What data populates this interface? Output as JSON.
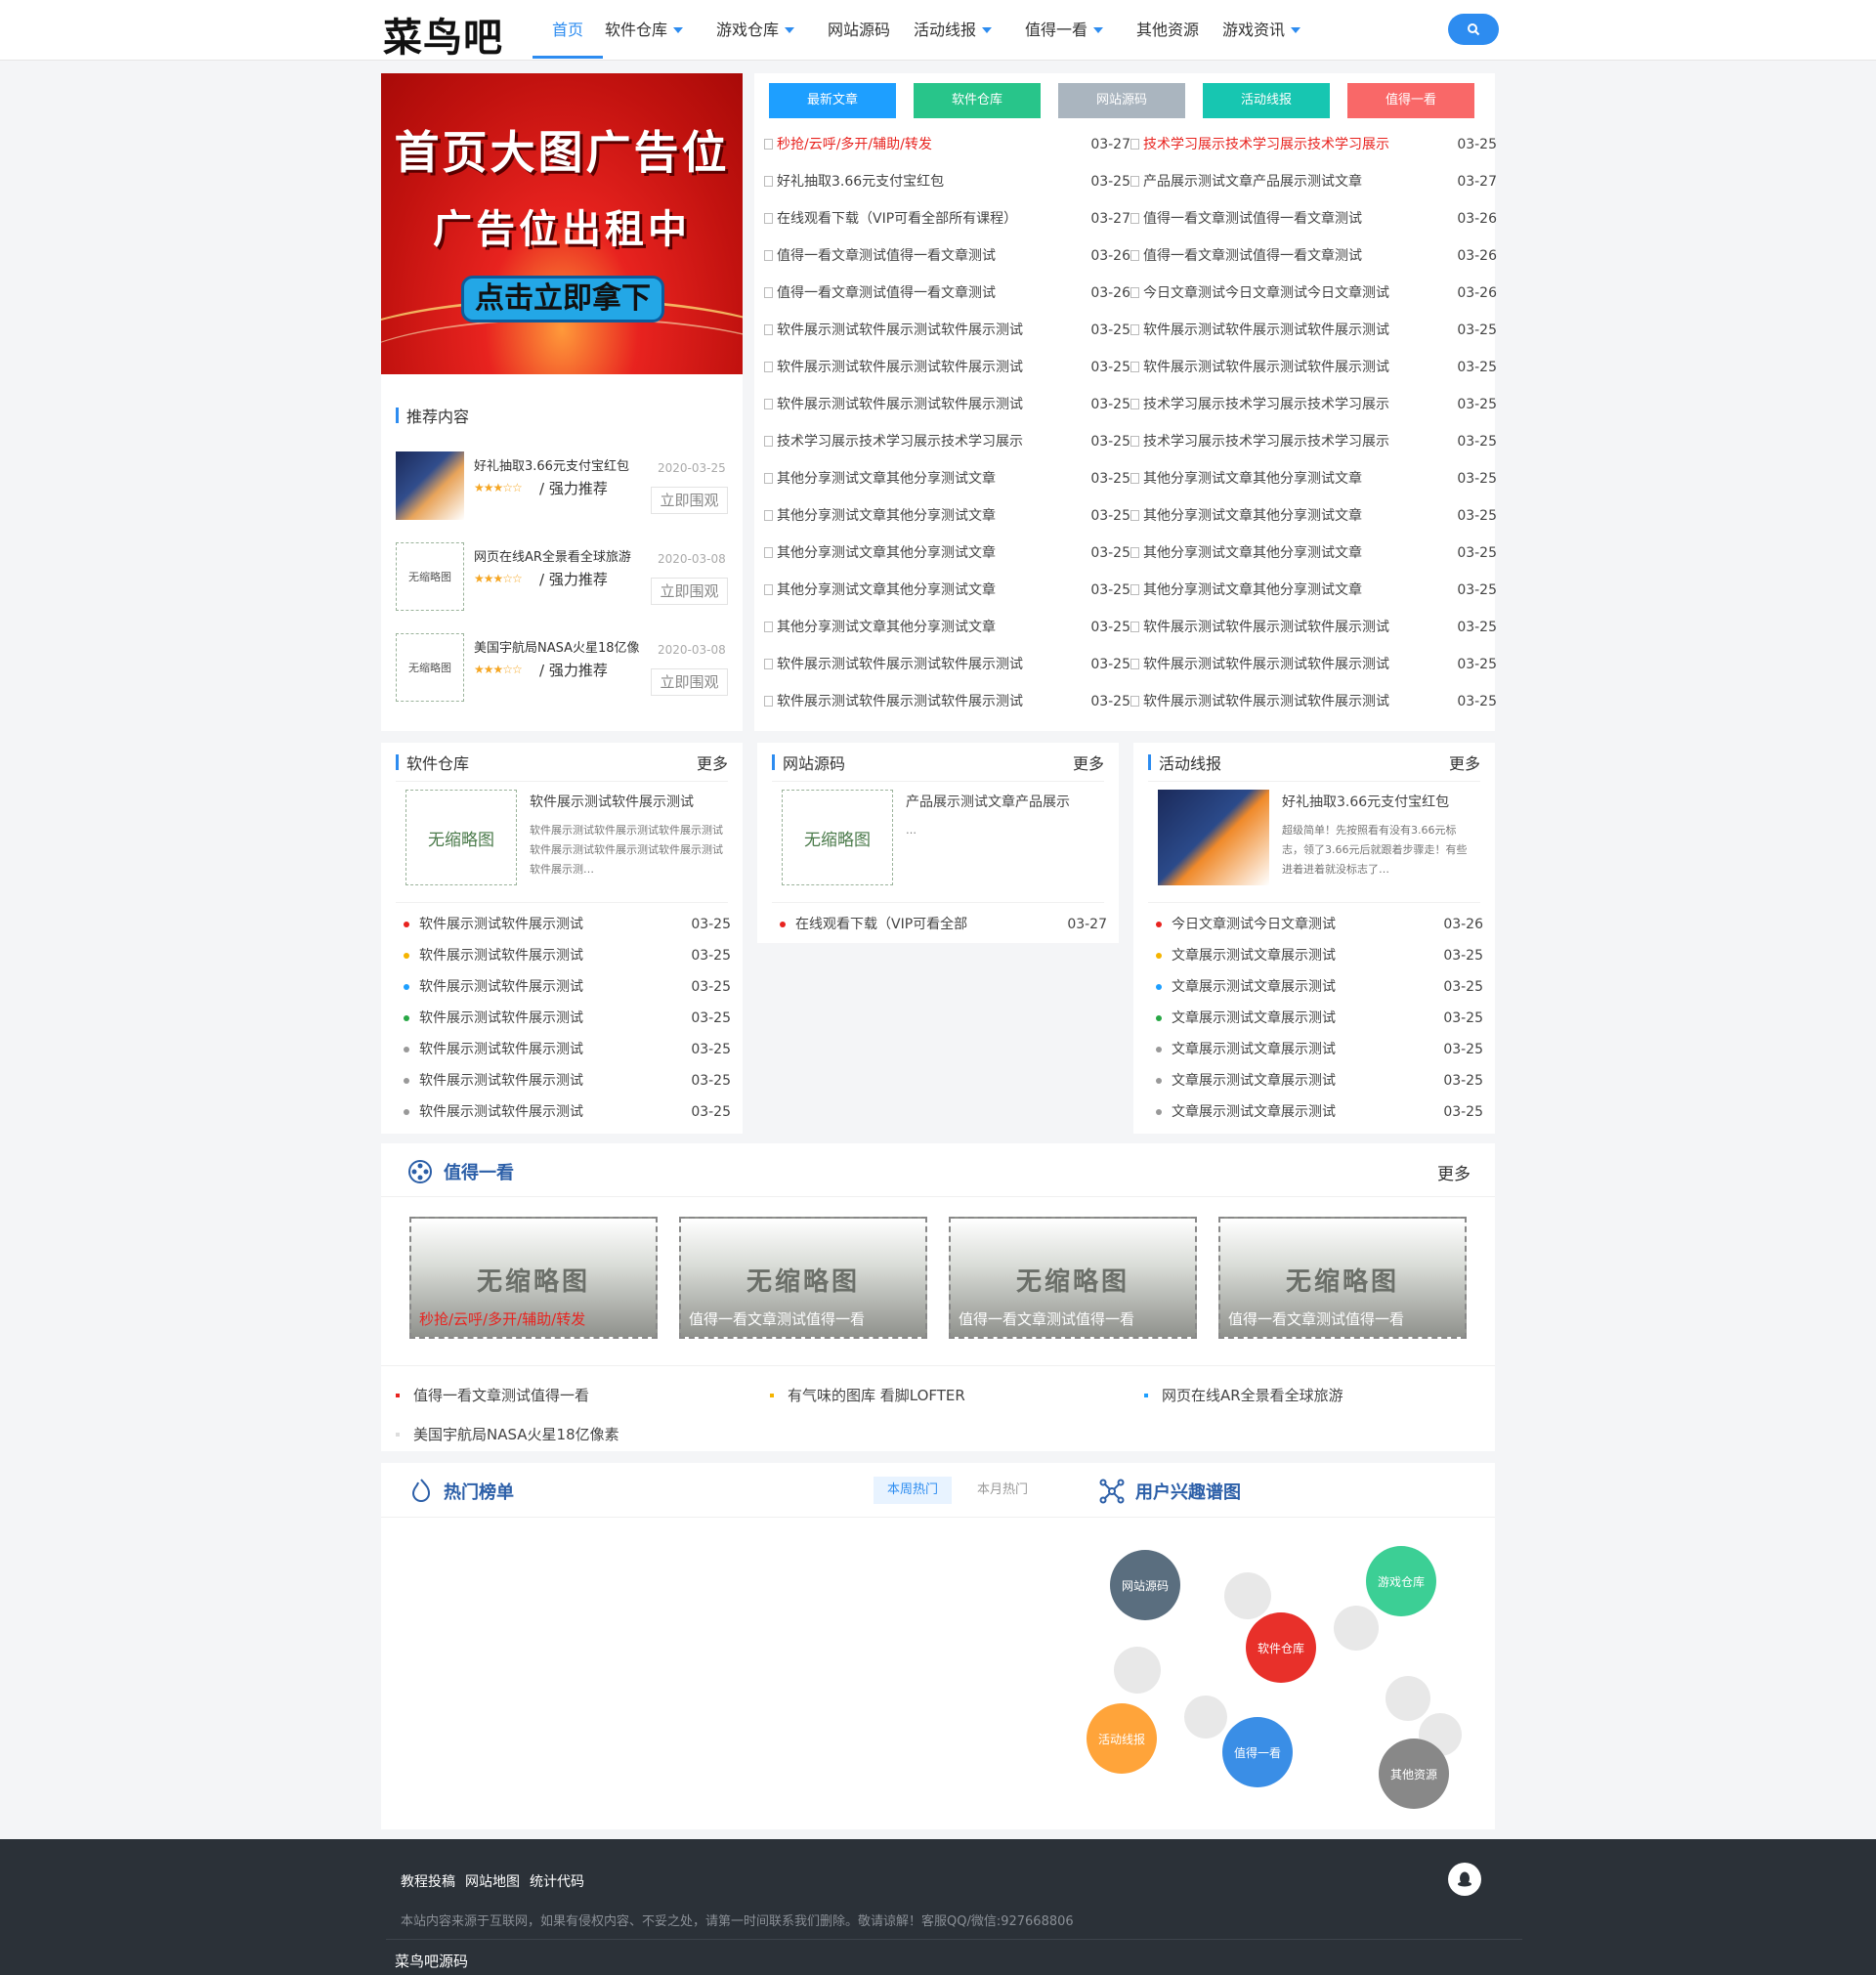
{
  "header": {
    "logo": "菜鸟吧",
    "nav": [
      {
        "label": "首页",
        "active": true,
        "dropdown": false
      },
      {
        "label": "软件仓库",
        "dropdown": true
      },
      {
        "label": "游戏仓库",
        "dropdown": true
      },
      {
        "label": "网站源码",
        "dropdown": false
      },
      {
        "label": "活动线报",
        "dropdown": true
      },
      {
        "label": "值得一看",
        "dropdown": true
      },
      {
        "label": "其他资源",
        "dropdown": false
      },
      {
        "label": "游戏资讯",
        "dropdown": true
      }
    ],
    "search_icon": "search-icon"
  },
  "banner": {
    "line1": "首页大图广告位",
    "line2": "广告位出租中",
    "button": "点击立即拿下"
  },
  "recommend": {
    "title": "推荐内容",
    "items": [
      {
        "title": "好礼抽取3.66元支付宝红包",
        "stars": "★★★☆☆",
        "tag": "/ 强力推荐",
        "date": "2020-03-25",
        "button": "立即围观",
        "thumb": ""
      },
      {
        "title": "网页在线AR全景看全球旅游",
        "stars": "★★★☆☆",
        "tag": "/ 强力推荐",
        "date": "2020-03-08",
        "button": "立即围观",
        "thumb": "无缩略图"
      },
      {
        "title": "美国宇航局NASA火星18亿像",
        "stars": "★★★☆☆",
        "tag": "/ 强力推荐",
        "date": "2020-03-08",
        "button": "立即围观",
        "thumb": "无缩略图"
      }
    ]
  },
  "tabs": [
    {
      "label": "最新文章",
      "color": "#1e9fff"
    },
    {
      "label": "软件仓库",
      "color": "#28c58a"
    },
    {
      "label": "网站源码",
      "color": "#aab5bf"
    },
    {
      "label": "活动线报",
      "color": "#17c6b1"
    },
    {
      "label": "值得一看",
      "color": "#f96868"
    }
  ],
  "articles_left": [
    {
      "title": "秒抢/云呼/多开/辅助/转发",
      "date": "03-27",
      "highlight": true
    },
    {
      "title": "好礼抽取3.66元支付宝红包",
      "date": "03-25"
    },
    {
      "title": "在线观看下载（VIP可看全部所有课程）",
      "date": "03-27"
    },
    {
      "title": "值得一看文章测试值得一看文章测试",
      "date": "03-26"
    },
    {
      "title": "值得一看文章测试值得一看文章测试",
      "date": "03-26"
    },
    {
      "title": "软件展示测试软件展示测试软件展示测试",
      "date": "03-25"
    },
    {
      "title": "软件展示测试软件展示测试软件展示测试",
      "date": "03-25"
    },
    {
      "title": "软件展示测试软件展示测试软件展示测试",
      "date": "03-25"
    },
    {
      "title": "技术学习展示技术学习展示技术学习展示",
      "date": "03-25"
    },
    {
      "title": "其他分享测试文章其他分享测试文章",
      "date": "03-25"
    },
    {
      "title": "其他分享测试文章其他分享测试文章",
      "date": "03-25"
    },
    {
      "title": "其他分享测试文章其他分享测试文章",
      "date": "03-25"
    },
    {
      "title": "其他分享测试文章其他分享测试文章",
      "date": "03-25"
    },
    {
      "title": "其他分享测试文章其他分享测试文章",
      "date": "03-25"
    },
    {
      "title": "软件展示测试软件展示测试软件展示测试",
      "date": "03-25"
    },
    {
      "title": "软件展示测试软件展示测试软件展示测试",
      "date": "03-25"
    }
  ],
  "articles_right": [
    {
      "title": "技术学习展示技术学习展示技术学习展示",
      "date": "03-25",
      "highlight": true
    },
    {
      "title": "产品展示测试文章产品展示测试文章",
      "date": "03-27"
    },
    {
      "title": "值得一看文章测试值得一看文章测试",
      "date": "03-26"
    },
    {
      "title": "值得一看文章测试值得一看文章测试",
      "date": "03-26"
    },
    {
      "title": "今日文章测试今日文章测试今日文章测试",
      "date": "03-26"
    },
    {
      "title": "软件展示测试软件展示测试软件展示测试",
      "date": "03-25"
    },
    {
      "title": "软件展示测试软件展示测试软件展示测试",
      "date": "03-25"
    },
    {
      "title": "技术学习展示技术学习展示技术学习展示",
      "date": "03-25"
    },
    {
      "title": "技术学习展示技术学习展示技术学习展示",
      "date": "03-25"
    },
    {
      "title": "其他分享测试文章其他分享测试文章",
      "date": "03-25"
    },
    {
      "title": "其他分享测试文章其他分享测试文章",
      "date": "03-25"
    },
    {
      "title": "其他分享测试文章其他分享测试文章",
      "date": "03-25"
    },
    {
      "title": "其他分享测试文章其他分享测试文章",
      "date": "03-25"
    },
    {
      "title": "软件展示测试软件展示测试软件展示测试",
      "date": "03-25"
    },
    {
      "title": "软件展示测试软件展示测试软件展示测试",
      "date": "03-25"
    },
    {
      "title": "软件展示测试软件展示测试软件展示测试",
      "date": "03-25"
    }
  ],
  "software": {
    "title": "软件仓库",
    "more": "更多",
    "thumb": "无缩略图",
    "card_title": "软件展示测试软件展示测试",
    "card_desc": "软件展示测试软件展示测试软件展示测试 软件展示测试软件展示测试软件展示测试 软件展示测…",
    "items": [
      {
        "title": "软件展示测试软件展示测试",
        "date": "03-25",
        "dot": "#e8231f"
      },
      {
        "title": "软件展示测试软件展示测试",
        "date": "03-25",
        "dot": "#f5b400"
      },
      {
        "title": "软件展示测试软件展示测试",
        "date": "03-25",
        "dot": "#1e9fff"
      },
      {
        "title": "软件展示测试软件展示测试",
        "date": "03-25",
        "dot": "#28a745"
      },
      {
        "title": "软件展示测试软件展示测试",
        "date": "03-25",
        "dot": "#999999"
      },
      {
        "title": "软件展示测试软件展示测试",
        "date": "03-25",
        "dot": "#999999"
      },
      {
        "title": "软件展示测试软件展示测试",
        "date": "03-25",
        "dot": "#999999"
      }
    ]
  },
  "source": {
    "title": "网站源码",
    "more": "更多",
    "thumb": "无缩略图",
    "card_title": "产品展示测试文章产品展示",
    "card_desc": "…",
    "items": [
      {
        "title": "在线观看下载（VIP可看全部",
        "date": "03-27",
        "dot": "#e8231f"
      }
    ]
  },
  "activity": {
    "title": "活动线报",
    "more": "更多",
    "card_title": "好礼抽取3.66元支付宝红包",
    "card_desc": "超级简单！先按照看有没有3.66元标志，领了3.66元后就跟着步骤走！有些进着进着就没标志了…",
    "items": [
      {
        "title": "今日文章测试今日文章测试",
        "date": "03-26",
        "dot": "#e8231f"
      },
      {
        "title": "文章展示测试文章展示测试",
        "date": "03-25",
        "dot": "#f5b400"
      },
      {
        "title": "文章展示测试文章展示测试",
        "date": "03-25",
        "dot": "#1e9fff"
      },
      {
        "title": "文章展示测试文章展示测试",
        "date": "03-25",
        "dot": "#28a745"
      },
      {
        "title": "文章展示测试文章展示测试",
        "date": "03-25",
        "dot": "#999999"
      },
      {
        "title": "文章展示测试文章展示测试",
        "date": "03-25",
        "dot": "#999999"
      },
      {
        "title": "文章展示测试文章展示测试",
        "date": "03-25",
        "dot": "#999999"
      }
    ]
  },
  "worth": {
    "title": "值得一看",
    "more": "更多",
    "cards": [
      {
        "thumb": "无缩略图",
        "caption": "秒抢/云呼/多开/辅助/转发",
        "red": true
      },
      {
        "thumb": "无缩略图",
        "caption": "值得一看文章测试值得一看"
      },
      {
        "thumb": "无缩略图",
        "caption": "值得一看文章测试值得一看"
      },
      {
        "thumb": "无缩略图",
        "caption": "值得一看文章测试值得一看"
      }
    ],
    "links": [
      {
        "title": "值得一看文章测试值得一看",
        "dot": "#e8231f"
      },
      {
        "title": "有气味的图库 看脚LOFTER",
        "dot": "#f5b400"
      },
      {
        "title": "网页在线AR全景看全球旅游",
        "dot": "#1e9fff"
      },
      {
        "title": "美国宇航局NASA火星18亿像素",
        "dot": "#dddddd"
      }
    ]
  },
  "hot": {
    "title": "热门榜单",
    "tab_week": "本周热门",
    "tab_month": "本月热门",
    "graph_title": "用户兴趣谱图",
    "bubbles": [
      {
        "label": "网站源码",
        "color": "#5a6e7f"
      },
      {
        "label": "游戏仓库",
        "color": "#3ccf95"
      },
      {
        "label": "软件仓库",
        "color": "#e8302a"
      },
      {
        "label": "活动线报",
        "color": "#ffa43a"
      },
      {
        "label": "值得一看",
        "color": "#3a8ee6"
      },
      {
        "label": "其他资源",
        "color": "#888888"
      }
    ]
  },
  "footer": {
    "links": [
      "教程投稿",
      "网站地图",
      "统计代码"
    ],
    "note": "本站内容来源于互联网，如果有侵权内容、不妥之处，请第一时间联系我们删除。敬请谅解！客服QQ/微信:927668806",
    "brand": "菜鸟吧源码"
  }
}
